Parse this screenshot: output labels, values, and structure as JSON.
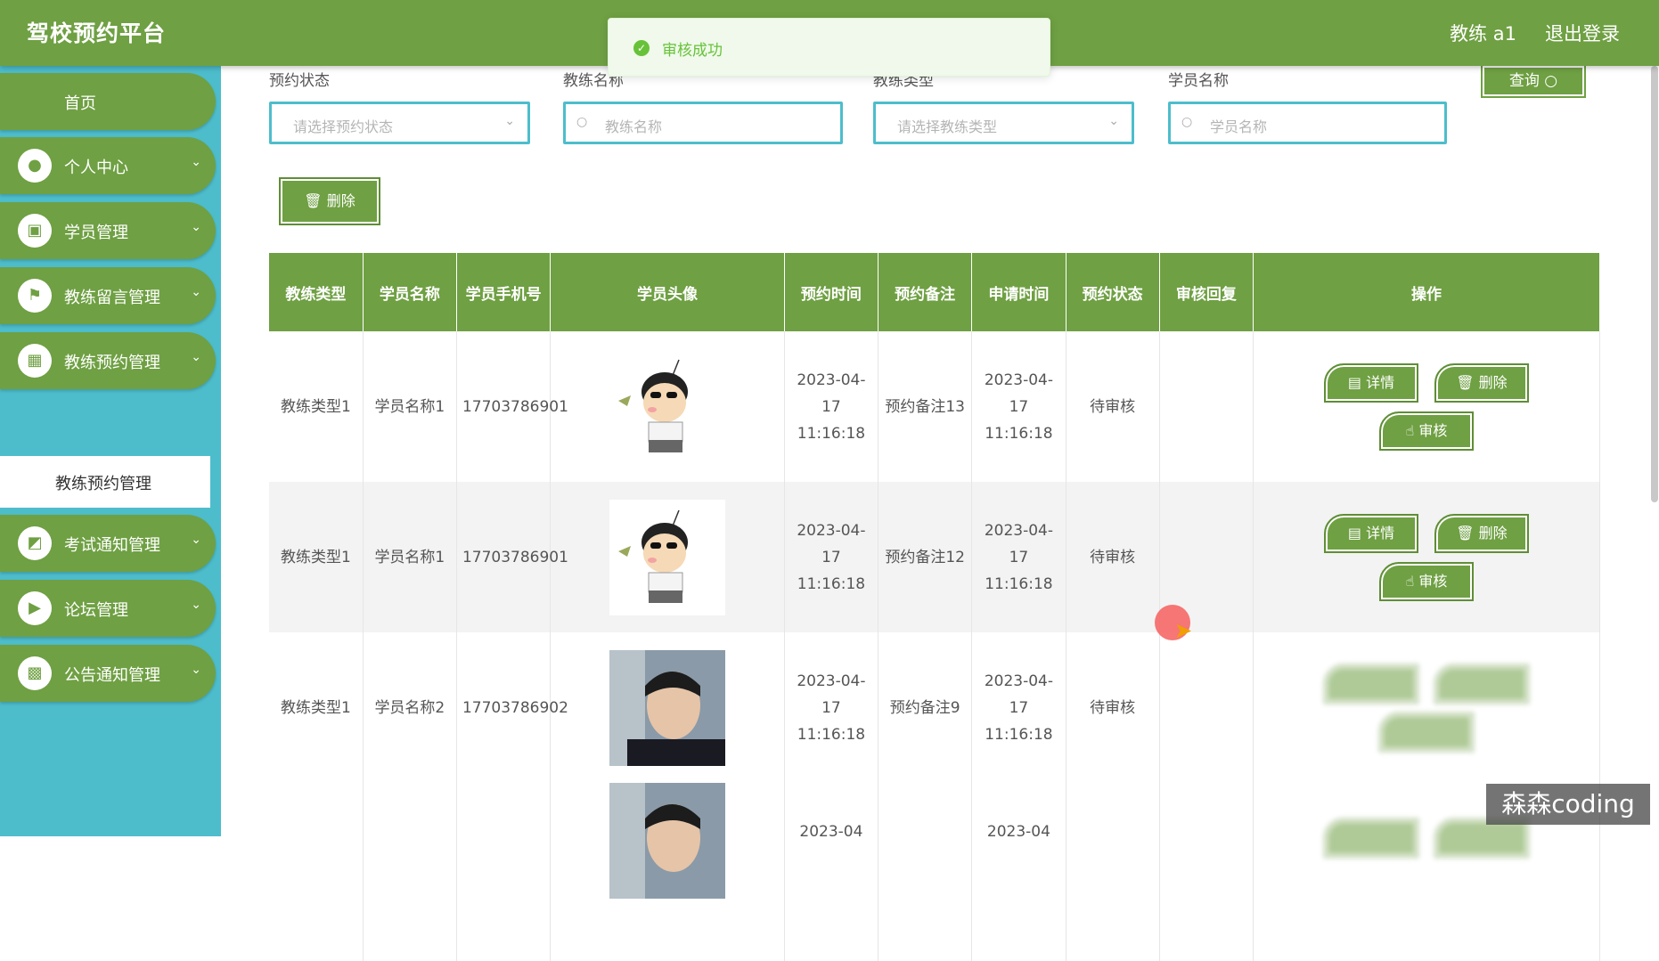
{
  "header": {
    "brand": "驾校预约平台",
    "user": "教练 a1",
    "logout": "退出登录"
  },
  "toast": {
    "icon": "check-circle-icon",
    "text": "审核成功"
  },
  "sidebar": {
    "home": "首页",
    "items": [
      {
        "label": "个人中心",
        "icon": "user-icon"
      },
      {
        "label": "学员管理",
        "icon": "clipboard-icon"
      },
      {
        "label": "教练留言管理",
        "icon": "flag-icon"
      },
      {
        "label": "教练预约管理",
        "icon": "grid-icon"
      },
      {
        "label": "考试通知管理",
        "icon": "chart-icon"
      },
      {
        "label": "论坛管理",
        "icon": "video-icon"
      },
      {
        "label": "公告通知管理",
        "icon": "apps-icon"
      }
    ],
    "active_sub": "教练预约管理"
  },
  "search": {
    "status_label": "预约状态",
    "status_placeholder": "请选择预约状态",
    "coach_name_label": "教练名称",
    "coach_name_placeholder": "教练名称",
    "coach_type_label": "教练类型",
    "coach_type_placeholder": "请选择教练类型",
    "student_name_label": "学员名称",
    "student_name_placeholder": "学员名称",
    "query": "查询"
  },
  "toolbar": {
    "delete": "删除"
  },
  "table": {
    "headers": [
      "教练类型",
      "学员名称",
      "学员手机号",
      "学员头像",
      "预约时间",
      "预约备注",
      "申请时间",
      "预约状态",
      "审核回复",
      "操作"
    ],
    "actions": {
      "detail": "详情",
      "delete": "删除",
      "review": "审核"
    },
    "rows": [
      {
        "coach_type": "教练类型1",
        "student": "学员名称1",
        "phone": "17703786901",
        "avatar": "cartoon-avatar",
        "appointment_time": "2023-04-17 11:16:18",
        "remark": "预约备注13",
        "apply_time": "2023-04-17 11:16:18",
        "status": "待审核",
        "reply": ""
      },
      {
        "coach_type": "教练类型1",
        "student": "学员名称1",
        "phone": "17703786901",
        "avatar": "cartoon-avatar",
        "appointment_time": "2023-04-17 11:16:18",
        "remark": "预约备注12",
        "apply_time": "2023-04-17 11:16:18",
        "status": "待审核",
        "reply": ""
      },
      {
        "coach_type": "教练类型1",
        "student": "学员名称2",
        "phone": "17703786902",
        "avatar": "photo-avatar",
        "appointment_time": "2023-04-17 11:16:18",
        "remark": "预约备注9",
        "apply_time": "2023-04-17 11:16:18",
        "status": "待审核",
        "reply": ""
      },
      {
        "coach_type": "",
        "student": "",
        "phone": "",
        "avatar": "photo-avatar",
        "appointment_time": "2023-04",
        "remark": "",
        "apply_time": "2023-04",
        "status": "",
        "reply": ""
      }
    ]
  },
  "watermark": "森森coding"
}
